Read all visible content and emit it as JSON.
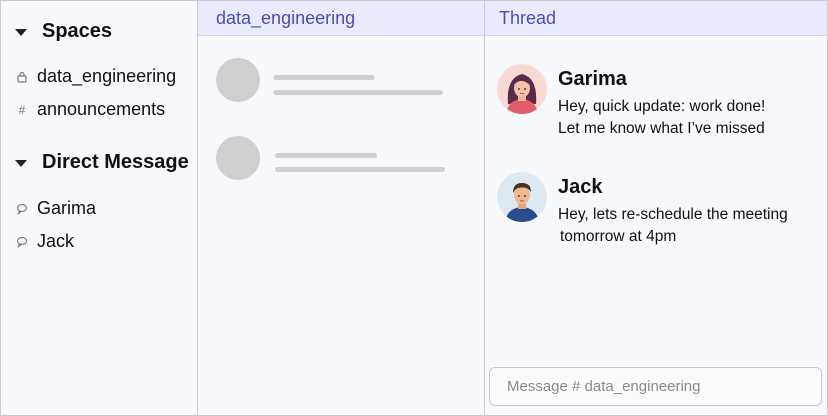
{
  "sidebar": {
    "spaces_header": "Spaces",
    "spaces": [
      {
        "label": "data_engineering",
        "icon": "lock-icon"
      },
      {
        "label": "announcements",
        "icon": "hash-icon"
      }
    ],
    "dm_header": "Direct Message",
    "direct_messages": [
      {
        "label": "Garima",
        "icon": "chat-bubble-icon"
      },
      {
        "label": "Jack",
        "icon": "chat-bubble-icon"
      }
    ]
  },
  "channel": {
    "title": "data_engineering"
  },
  "thread": {
    "title": "Thread",
    "messages": [
      {
        "author": "Garima",
        "lines": [
          "Hey, quick update: work done!",
          "Let me know what I’ve missed"
        ]
      },
      {
        "author": "Jack",
        "lines": [
          "Hey, lets re-schedule the meeting",
          "tomorrow at 4pm"
        ]
      }
    ],
    "composer_placeholder": "Message  # data_engineering"
  },
  "colors": {
    "header_bg": "#e9eafb",
    "header_text": "#4a4fb1",
    "skeleton": "#cfcfcf",
    "panel_bg": "#f7f8fb"
  }
}
